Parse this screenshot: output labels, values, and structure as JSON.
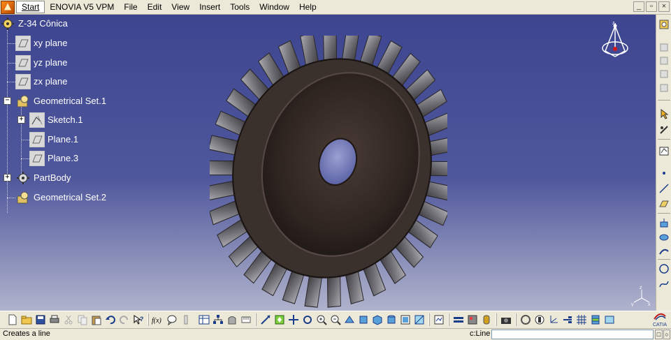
{
  "menubar": {
    "start": "Start",
    "items": [
      {
        "label": "ENOVIA V5 VPM",
        "mnemonic": ""
      },
      {
        "label": "File",
        "mnemonic": "F"
      },
      {
        "label": "Edit",
        "mnemonic": "E"
      },
      {
        "label": "View",
        "mnemonic": "V"
      },
      {
        "label": "Insert",
        "mnemonic": "I"
      },
      {
        "label": "Tools",
        "mnemonic": "T"
      },
      {
        "label": "Window",
        "mnemonic": "W"
      },
      {
        "label": "Help",
        "mnemonic": "H"
      }
    ],
    "window_controls": [
      "minimize-icon",
      "restore-icon",
      "close-icon"
    ]
  },
  "tree": {
    "root": "Z-34 Cônica",
    "nodes": [
      {
        "label": "xy plane",
        "icon": "plane-icon"
      },
      {
        "label": "yz plane",
        "icon": "plane-icon"
      },
      {
        "label": "zx plane",
        "icon": "plane-icon"
      },
      {
        "label": "Geometrical Set.1",
        "icon": "geometrical-set-icon"
      },
      {
        "label": "Sketch.1",
        "icon": "sketch-icon"
      },
      {
        "label": "Plane.1",
        "icon": "plane-icon"
      },
      {
        "label": "Plane.3",
        "icon": "plane-icon"
      },
      {
        "label": "PartBody",
        "icon": "partbody-icon"
      },
      {
        "label": "Geometrical Set.2",
        "icon": "geometrical-set-icon"
      }
    ]
  },
  "compass": {
    "axis_label": "z"
  },
  "axis_mini": {
    "x": "x",
    "y": "y",
    "z": "z"
  },
  "right_toolbar": [
    "isolate-icon",
    "part-design-icon",
    "catalog-icon",
    "select-icon",
    "sketcher-icon",
    "sketch-icon",
    "point-icon",
    "line-icon",
    "plane-icon",
    "extrude-icon",
    "revolve-icon",
    "sweep-icon",
    "circle-icon",
    "spline-icon"
  ],
  "bottom_toolbar": [
    "new-icon",
    "open-icon",
    "save-icon",
    "print-icon",
    "cut-icon",
    "copy-icon",
    "paste-icon",
    "undo-icon",
    "redo-icon",
    "whats-this-icon",
    "formula-icon",
    "knowledge-icon",
    "parameter-icon",
    "table-icon",
    "hierarchy-icon",
    "capture-icon",
    "measure-icon",
    "fly-icon",
    "fit-all-icon",
    "pan-icon",
    "rotate-icon",
    "zoom-in-icon",
    "zoom-out-icon",
    "normal-view-icon",
    "iso-view-icon",
    "multi-view-icon",
    "shading-icon",
    "hide-show-icon",
    "swap-space-icon",
    "render-icon",
    "lighting-icon",
    "material-icon",
    "snapshot-icon",
    "link-icon",
    "hand-icon",
    "axis-icon",
    "tree-icon",
    "grid-icon",
    "layer-icon",
    "filter-icon"
  ],
  "catia": {
    "logo_text": "CATIA"
  },
  "statusbar": {
    "message": "Creates a line",
    "command_label": "c:Line",
    "command_value": ""
  },
  "colors": {
    "viewport_top": "#3d4590",
    "viewport_bottom": "#b0b3cc",
    "tree_text": "#ffffff",
    "chrome": "#ece9d8"
  }
}
